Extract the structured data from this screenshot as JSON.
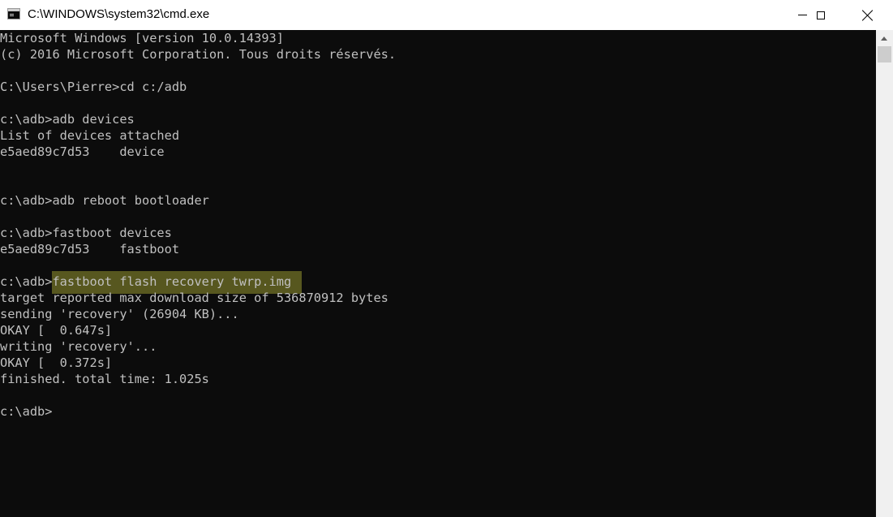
{
  "window": {
    "title": "C:\\WINDOWS\\system32\\cmd.exe"
  },
  "console": {
    "lines": [
      "Microsoft Windows [version 10.0.14393]",
      "(c) 2016 Microsoft Corporation. Tous droits réservés.",
      "",
      "C:\\Users\\Pierre>cd c:/adb",
      "",
      "c:\\adb>adb devices",
      "List of devices attached",
      "e5aed89c7d53    device",
      "",
      "",
      "c:\\adb>adb reboot bootloader",
      "",
      "c:\\adb>fastboot devices",
      "e5aed89c7d53    fastboot",
      "",
      "c:\\adb>",
      "target reported max download size of 536870912 bytes",
      "sending 'recovery' (26904 KB)...",
      "OKAY [  0.647s]",
      "writing 'recovery'...",
      "OKAY [  0.372s]",
      "finished. total time: 1.025s",
      "",
      "c:\\adb>"
    ],
    "highlighted_command": "fastboot flash recovery twrp.img",
    "highlight_color": "#57571f",
    "text_color": "#c0c0c0",
    "background_color": "#0c0c0c"
  }
}
